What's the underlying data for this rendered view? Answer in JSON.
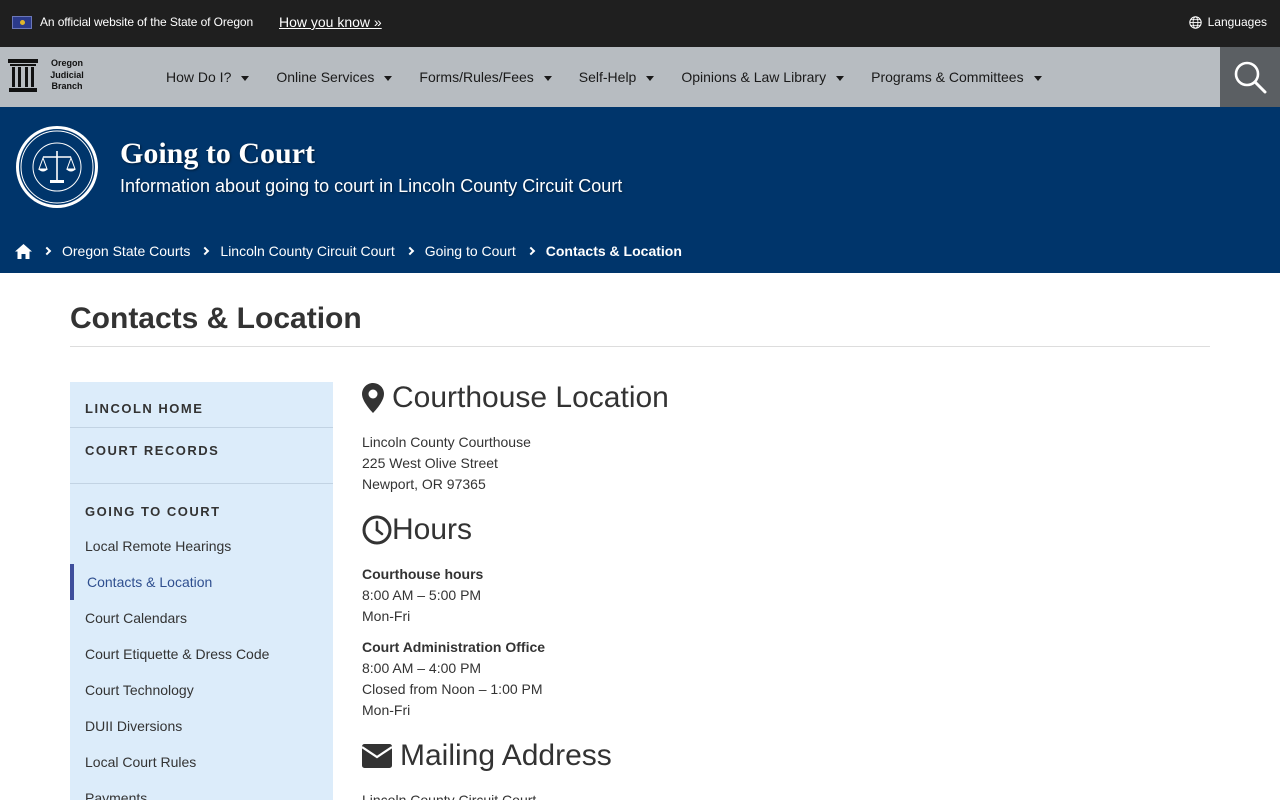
{
  "topbar": {
    "official_text": "An official website of the State of Oregon",
    "how_you_know": "How you know »",
    "languages": "Languages"
  },
  "logo": {
    "line1": "Oregon",
    "line2": "Judicial",
    "line3": "Branch"
  },
  "nav": {
    "items": [
      {
        "label": "How Do I?"
      },
      {
        "label": "Online Services"
      },
      {
        "label": "Forms/Rules/Fees"
      },
      {
        "label": "Self-Help"
      },
      {
        "label": "Opinions & Law Library"
      },
      {
        "label": "Programs & Committees"
      }
    ]
  },
  "banner": {
    "title": "Going to Court",
    "subtitle": "Information about going to court in Lincoln County Circuit Court"
  },
  "breadcrumb": [
    {
      "label": "Oregon State Courts"
    },
    {
      "label": "Lincoln County Circuit Court"
    },
    {
      "label": "Going to Court"
    },
    {
      "label": "Contacts & Location"
    }
  ],
  "page": {
    "title": "Contacts & Location"
  },
  "sidebar": {
    "headings": [
      "LINCOLN HOME",
      "COURT RECORDS",
      "GOING TO COURT"
    ],
    "items": [
      {
        "label": "Local Remote Hearings"
      },
      {
        "label": "Contacts & Location"
      },
      {
        "label": "Court Calendars"
      },
      {
        "label": "Court Etiquette & Dress Code"
      },
      {
        "label": "Court Technology"
      },
      {
        "label": "DUII Diversions"
      },
      {
        "label": "Local Court Rules"
      },
      {
        "label": "Payments"
      }
    ]
  },
  "main": {
    "location": {
      "heading": "Courthouse Location",
      "lines": [
        "Lincoln County Courthouse",
        "225 West Olive Street",
        "Newport, OR  97365"
      ]
    },
    "hours": {
      "heading": "Hours",
      "courthouse_label": "Courthouse hours",
      "courthouse_lines": [
        "8:00 AM – 5:00 PM",
        "Mon-Fri"
      ],
      "admin_label": "Court Administration Office",
      "admin_lines": [
        "8:00 AM – 4:00 PM",
        "Closed from Noon – 1:00 PM",
        "Mon-Fri"
      ]
    },
    "mailing": {
      "heading": "Mailing Address",
      "lines": [
        "Lincoln County Circuit Court"
      ]
    }
  },
  "colors": {
    "topbar": "#1f1f1f",
    "navbar": "#b7bcc1",
    "banner": "#00356b",
    "sidebar": "#dcecfa",
    "active_accent": "#3f4f9c"
  }
}
